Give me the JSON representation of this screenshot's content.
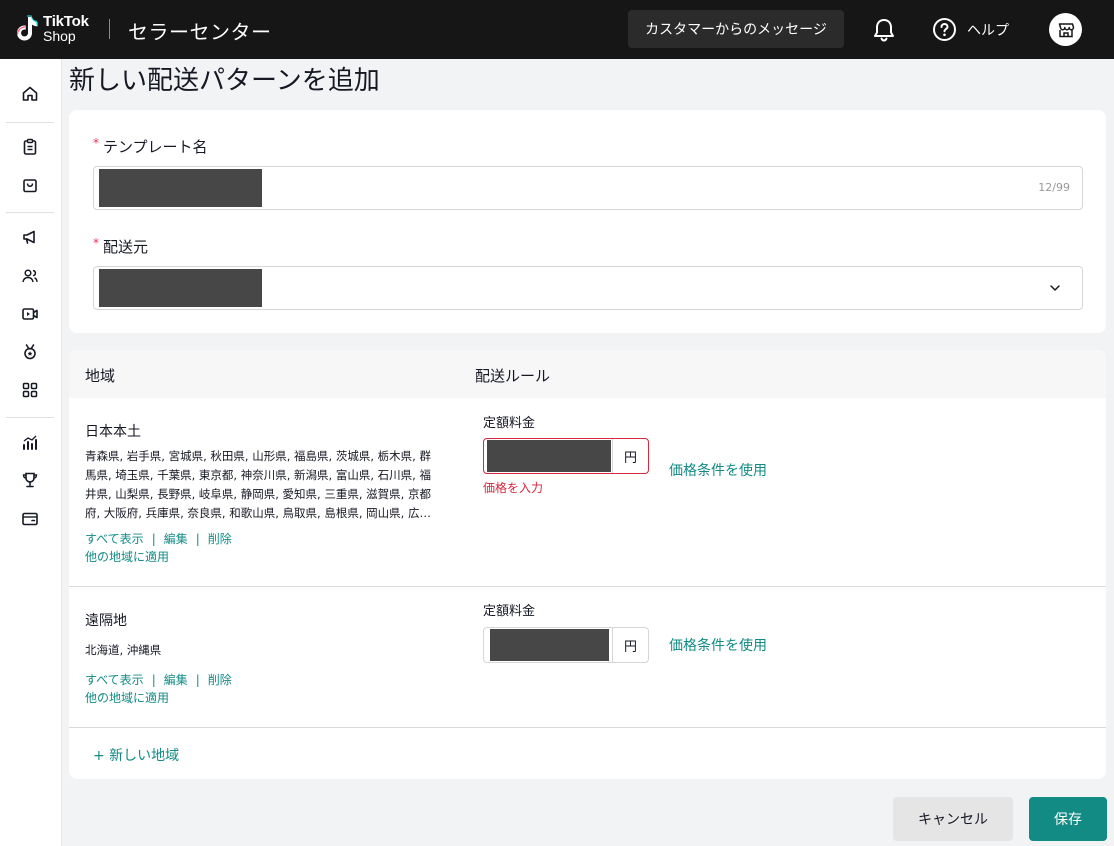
{
  "topbar": {
    "logo_line1": "TikTok",
    "logo_line2": "Shop",
    "app_title": "セラーセンター",
    "messages_button": "カスタマーからのメッセージ",
    "help_label": "ヘルプ"
  },
  "sidebar": {
    "icons": [
      "home-icon",
      "clipboard-icon",
      "bag-icon",
      "megaphone-icon",
      "users-icon",
      "video-icon",
      "medal-icon",
      "apps-icon",
      "analytics-icon",
      "trophy-icon",
      "wallet-icon"
    ]
  },
  "page": {
    "title": "新しい配送パターンを追加"
  },
  "form": {
    "template_name_label": "テンプレート名",
    "template_name_counter": "12/99",
    "origin_label": "配送元"
  },
  "table": {
    "col_region": "地域",
    "col_rule": "配送ルール",
    "rows": [
      {
        "name": "日本本土",
        "prefectures": "青森県, 岩手県, 宮城県, 秋田県, 山形県, 福島県, 茨城県, 栃木県, 群馬県, 埼玉県, 千葉県, 東京都, 神奈川県, 新潟県, 富山県, 石川県, 福井県, 山梨県, 長野県, 岐阜県, 静岡県, 愛知県, 三重県, 滋賀県, 京都府, 大阪府, 兵庫県, 奈良県, 和歌山県, 鳥取県, 島根県, 岡山県, 広…",
        "show_all": "すべて表示",
        "edit": "編集",
        "delete": "削除",
        "apply_other": "他の地域に適用",
        "rule_label": "定額料金",
        "currency": "円",
        "error": "価格を入力",
        "condition_link": "価格条件を使用"
      },
      {
        "name": "遠隔地",
        "prefectures": "北海道, 沖縄県",
        "show_all": "すべて表示",
        "edit": "編集",
        "delete": "削除",
        "apply_other": "他の地域に適用",
        "rule_label": "定額料金",
        "currency": "円",
        "condition_link": "価格条件を使用"
      }
    ],
    "add_region": "+ 新しい地域"
  },
  "footer": {
    "cancel": "キャンセル",
    "save": "保存"
  },
  "colors": {
    "accent": "#128b85",
    "error": "#d7263d",
    "topbar": "#161616"
  }
}
